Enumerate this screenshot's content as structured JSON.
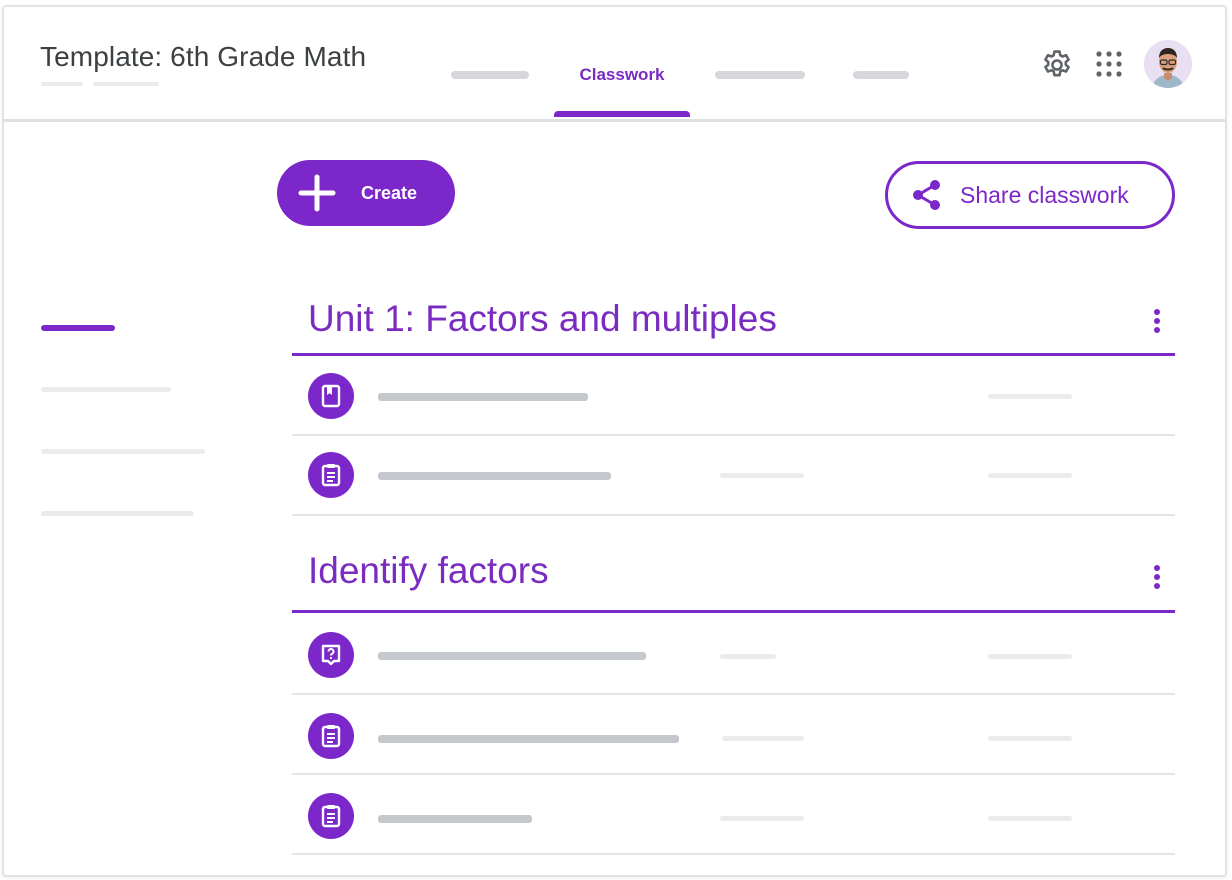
{
  "header": {
    "title": "Template: 6th Grade Math",
    "tabs": [
      {
        "label": "",
        "active": false
      },
      {
        "label": "Classwork",
        "active": true
      },
      {
        "label": "",
        "active": false
      },
      {
        "label": "",
        "active": false
      }
    ],
    "icons": [
      "gear-icon",
      "apps-grid-icon",
      "avatar"
    ]
  },
  "toolbar": {
    "create_label": "Create",
    "share_label": "Share classwork"
  },
  "topics": [
    {
      "title": "Unit 1: Factors and multiples",
      "items": [
        {
          "icon": "material-icon"
        },
        {
          "icon": "assignment-icon"
        }
      ]
    },
    {
      "title": "Identify factors",
      "items": [
        {
          "icon": "question-icon"
        },
        {
          "icon": "assignment-icon"
        },
        {
          "icon": "assignment-icon"
        }
      ]
    }
  ],
  "colors": {
    "accent": "#7b27c9",
    "title_text": "#3c4043",
    "divider": "#e0e0e0",
    "placeholder": "#c4c7cb"
  }
}
